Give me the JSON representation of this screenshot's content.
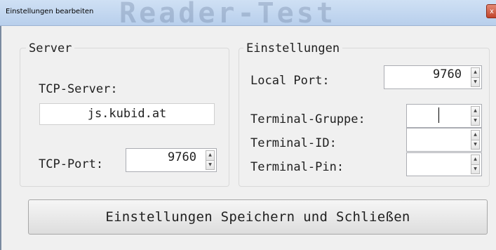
{
  "window": {
    "title": "Einstellungen bearbeiten",
    "background_title": "Reader-Test",
    "close_glyph": "x"
  },
  "server": {
    "legend": "Server",
    "tcp_server_label": "TCP-Server:",
    "tcp_server_value": "js.kubid.at",
    "tcp_port_label": "TCP-Port:",
    "tcp_port_value": "9760"
  },
  "settings": {
    "legend": "Einstellungen",
    "local_port_label": "Local Port:",
    "local_port_value": "9760",
    "terminal_group_label": "Terminal-Gruppe:",
    "terminal_group_value": "",
    "terminal_id_label": "Terminal-ID:",
    "terminal_id_value": "",
    "terminal_pin_label": "Terminal-Pin:",
    "terminal_pin_value": ""
  },
  "actions": {
    "save_close_label": "Einstellungen Speichern und Schließen"
  },
  "spinner": {
    "up_icon": "up-arrow-icon",
    "down_icon": "down-arrow-icon"
  }
}
